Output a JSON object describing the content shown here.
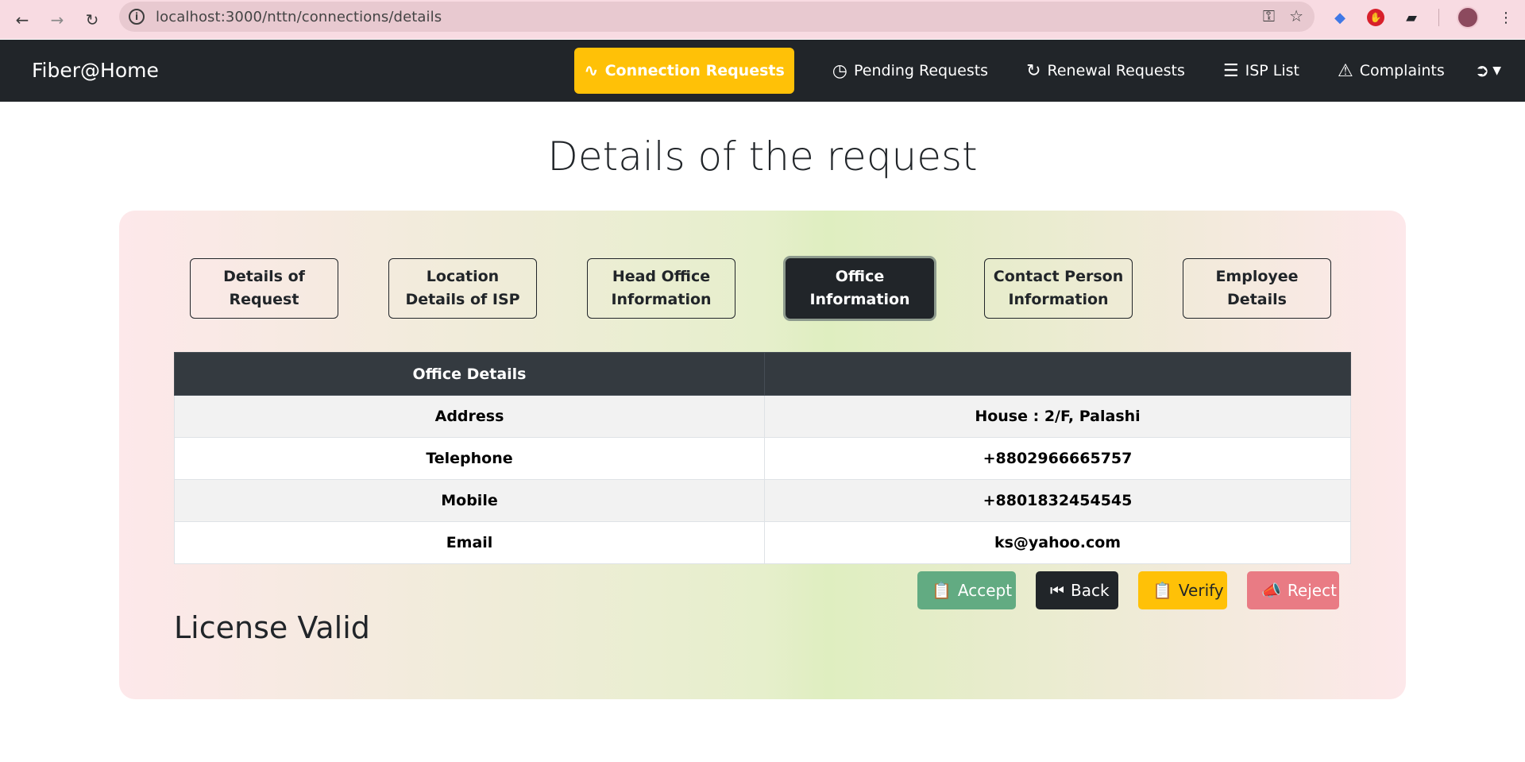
{
  "browser": {
    "url": "localhost:3000/nttn/connections/details"
  },
  "navbar": {
    "brand": "Fiber@Home",
    "items": [
      {
        "label": "Connection Requests",
        "icon": "wifi-icon",
        "active": true
      },
      {
        "label": "Pending Requests",
        "icon": "clock-icon",
        "active": false
      },
      {
        "label": "Renewal Requests",
        "icon": "refresh-icon",
        "active": false
      },
      {
        "label": "ISP List",
        "icon": "list-icon",
        "active": false
      },
      {
        "label": "Complaints",
        "icon": "warning-icon",
        "active": false
      }
    ]
  },
  "page": {
    "title": "Details of the request"
  },
  "tabs": [
    {
      "line1": "Details of",
      "line2": "Request",
      "active": false
    },
    {
      "line1": "Location",
      "line2": "Details of ISP",
      "active": false
    },
    {
      "line1": "Head Office",
      "line2": "Information",
      "active": false
    },
    {
      "line1": "Office",
      "line2": "Information",
      "active": true
    },
    {
      "line1": "Contact Person",
      "line2": "Information",
      "active": false
    },
    {
      "line1": "Employee",
      "line2": "Details",
      "active": false
    }
  ],
  "table": {
    "header": [
      "Office Details",
      ""
    ],
    "rows": [
      [
        "Address",
        "House : 2/F, Palashi"
      ],
      [
        "Telephone",
        "+8802966665757"
      ],
      [
        "Mobile",
        "+8801832454545"
      ],
      [
        "Email",
        "ks@yahoo.com"
      ]
    ]
  },
  "actions": {
    "accept": "Accept",
    "back": "Back",
    "verify": "Verify",
    "reject": "Reject"
  },
  "status": {
    "license": "License Valid"
  },
  "colors": {
    "navbar": "#212529",
    "active_nav": "#ffc107",
    "accept": "#62ab82",
    "reject": "#e97b84"
  }
}
